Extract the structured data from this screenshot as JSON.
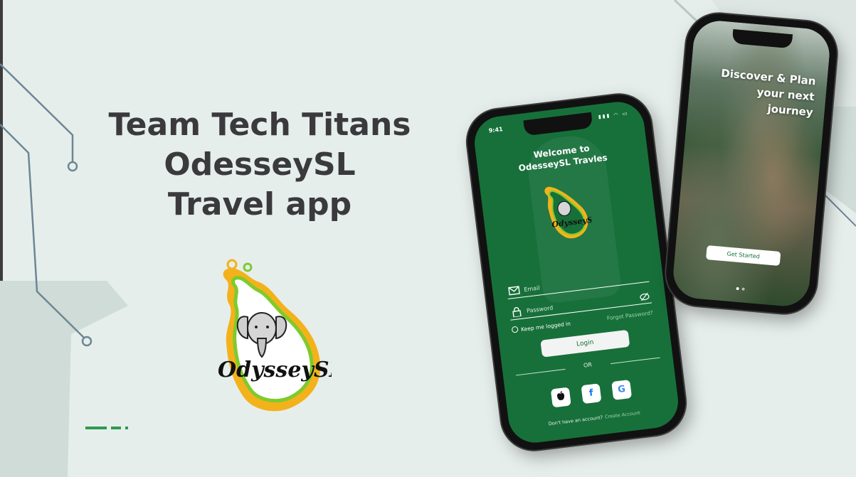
{
  "headline": {
    "line1": "Team Tech Titans",
    "line2": "OdesseySL",
    "line3": "Travel app"
  },
  "logo": {
    "text": "OdysseySL"
  },
  "colors": {
    "brand_green": "#17703a",
    "accent_green": "#2e9b53",
    "yellow": "#f3b21b",
    "lime": "#7ecb2c",
    "background": "#e6eeec",
    "title": "#3a3a3c"
  },
  "login_screen": {
    "status_time": "9:41",
    "welcome_line1": "Welcome to",
    "welcome_line2": "OdesseySL Travles",
    "email_placeholder": "Email",
    "password_placeholder": "Password",
    "keep_logged_in": "Keep me logged in",
    "forgot_password": "Forgot Password?",
    "login_button": "Login",
    "or_text": "OR",
    "social": [
      {
        "name": "apple",
        "icon": "apple-icon",
        "glyph": ""
      },
      {
        "name": "facebook",
        "icon": "facebook-icon",
        "glyph": "f"
      },
      {
        "name": "google",
        "icon": "google-icon",
        "glyph": "G"
      }
    ],
    "footer_text": "Don't have an account?",
    "create_account": "Create Account"
  },
  "onboarding_screen": {
    "headline_line1": "Discover & Plan",
    "headline_line2": "your next",
    "headline_line3": "journey",
    "get_started": "Get Started",
    "page_indicator": {
      "pages": 2,
      "active": 1
    }
  }
}
